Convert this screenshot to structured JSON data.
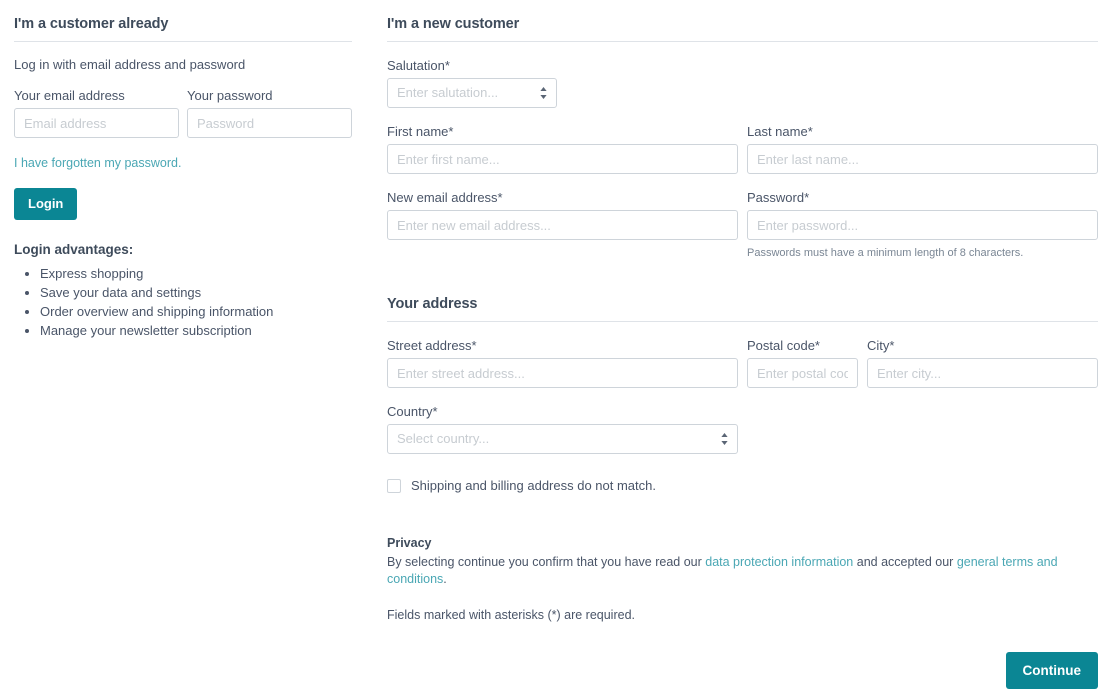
{
  "colors": {
    "accent": "#0b8694",
    "link": "#4aa7b4",
    "text": "#4a5568",
    "heading": "#3e4b5b",
    "border": "#ced4da",
    "placeholder": "#c7ccd1"
  },
  "login": {
    "heading": "I'm a customer already",
    "subtitle": "Log in with email address and password",
    "email_label": "Your email address",
    "email_placeholder": "Email address",
    "email_value": "",
    "password_label": "Your password",
    "password_placeholder": "Password",
    "password_value": "",
    "forgot_link": "I have forgotten my password.",
    "login_button": "Login",
    "advantages_title": "Login advantages:",
    "advantages": [
      "Express shopping",
      "Save your data and settings",
      "Order overview and shipping information",
      "Manage your newsletter subscription"
    ]
  },
  "register": {
    "heading": "I'm a new customer",
    "salutation_label": "Salutation*",
    "salutation_placeholder": "Enter salutation...",
    "salutation_value": "Enter salutation...",
    "first_name_label": "First name*",
    "first_name_placeholder": "Enter first name...",
    "first_name_value": "",
    "last_name_label": "Last name*",
    "last_name_placeholder": "Enter last name...",
    "last_name_value": "",
    "email_label": "New email address*",
    "email_placeholder": "Enter new email address...",
    "email_value": "",
    "password_label": "Password*",
    "password_placeholder": "Enter password...",
    "password_value": "",
    "password_hint": "Passwords must have a minimum length of 8 characters."
  },
  "address": {
    "heading": "Your address",
    "street_label": "Street address*",
    "street_placeholder": "Enter street address...",
    "street_value": "",
    "postal_label": "Postal code*",
    "postal_placeholder": "Enter postal code...",
    "postal_value": "",
    "city_label": "City*",
    "city_placeholder": "Enter city...",
    "city_value": "",
    "country_label": "Country*",
    "country_placeholder": "Select country...",
    "country_value": "Select country...",
    "shipping_checkbox_label": "Shipping and billing address do not match.",
    "shipping_checkbox_checked": false
  },
  "privacy": {
    "title": "Privacy",
    "text_before": "By selecting continue you confirm that you have read our ",
    "link_data_protection": "data protection information",
    "text_middle": " and accepted our ",
    "link_terms": "general terms and conditions",
    "text_after": ".",
    "required_note": "Fields marked with asterisks (*) are required.",
    "continue_button": "Continue"
  }
}
